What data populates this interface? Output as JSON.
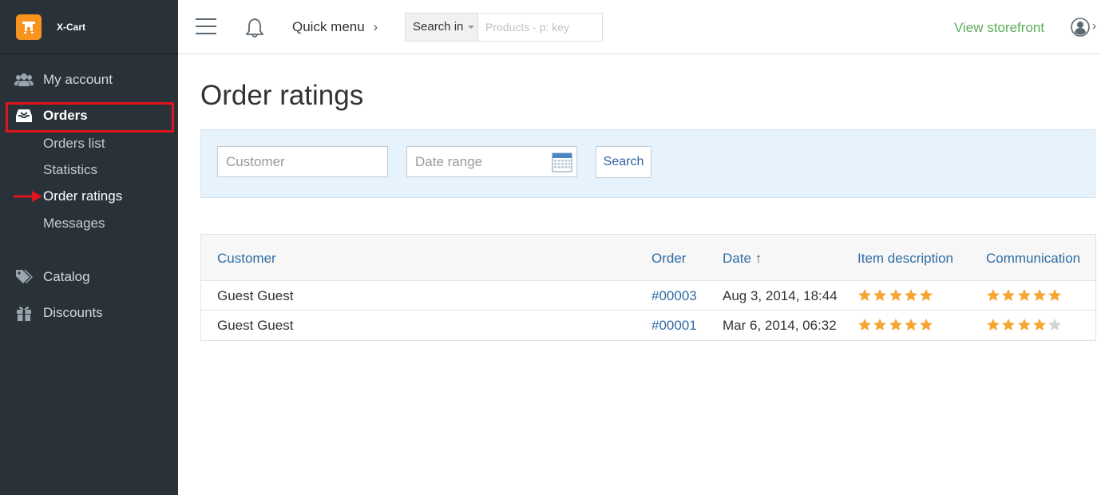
{
  "brand": {
    "name": "X-Cart",
    "logo_color": "#f7931e"
  },
  "sidebar": {
    "items": [
      {
        "label": "My account",
        "icon": "users-icon"
      },
      {
        "label": "Orders",
        "icon": "inbox-icon"
      },
      {
        "label": "Catalog",
        "icon": "tags-icon"
      },
      {
        "label": "Discounts",
        "icon": "gift-icon"
      }
    ],
    "orders_sub": [
      {
        "label": "Orders list"
      },
      {
        "label": "Statistics"
      },
      {
        "label": "Order ratings"
      },
      {
        "label": "Messages"
      }
    ]
  },
  "topbar": {
    "quick_menu": "Quick menu",
    "search_in": "Search in",
    "search_placeholder": "Products - p: key",
    "view_storefront": "View storefront"
  },
  "page": {
    "title": "Order ratings"
  },
  "filters": {
    "customer_placeholder": "Customer",
    "date_placeholder": "Date range",
    "search_button": "Search"
  },
  "table": {
    "headers": {
      "customer": "Customer",
      "order": "Order",
      "date": "Date",
      "date_sort": "↑",
      "item_description": "Item description",
      "communication": "Communication"
    },
    "rows": [
      {
        "customer": "Guest Guest",
        "order": "#00003",
        "date": "Aug 3, 2014, 18:44",
        "item_rating": 5,
        "communication_rating": 5
      },
      {
        "customer": "Guest Guest",
        "order": "#00001",
        "date": "Mar 6, 2014, 06:32",
        "item_rating": 5,
        "communication_rating": 4
      }
    ]
  },
  "colors": {
    "sidebar_bg": "#283238",
    "accent_green": "#5cad5a",
    "link_blue": "#2f6ca3",
    "star_filled": "#f7a531",
    "star_empty": "#d4d4d4",
    "highlight_red": "#e1141f"
  }
}
